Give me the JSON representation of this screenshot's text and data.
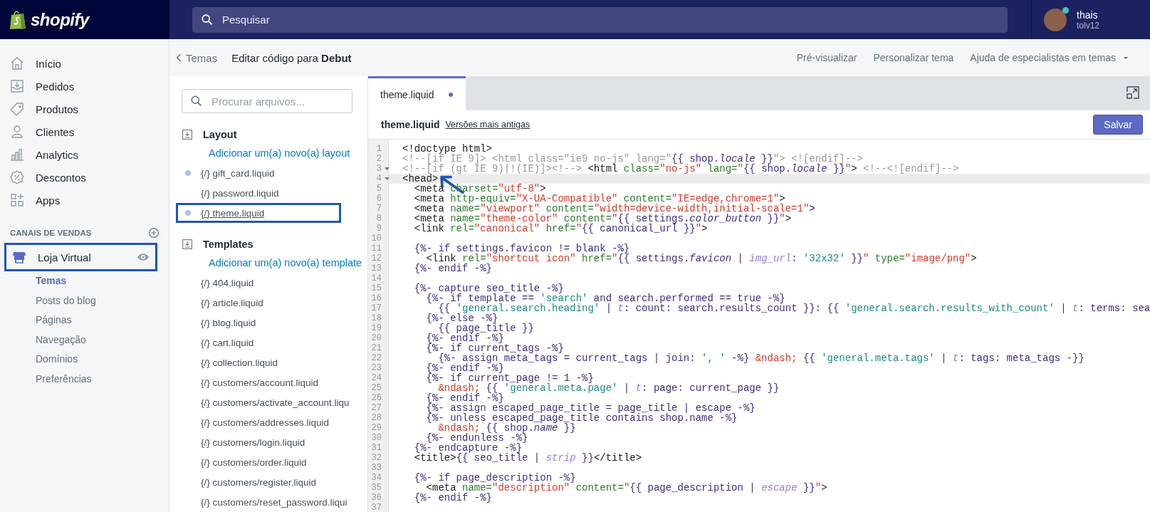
{
  "topbar": {
    "logo": "shopify",
    "search": {
      "placeholder": "Pesquisar"
    },
    "user": {
      "name": "thais",
      "store": "tolv12",
      "online": true
    }
  },
  "nav": {
    "items": [
      {
        "label": "Início",
        "selected": false
      },
      {
        "label": "Pedidos",
        "selected": false
      },
      {
        "label": "Produtos",
        "selected": false
      },
      {
        "label": "Clientes",
        "selected": false
      },
      {
        "label": "Analytics",
        "selected": false
      },
      {
        "label": "Descontos",
        "selected": false
      },
      {
        "label": "Apps",
        "selected": false
      }
    ],
    "channels_heading": "CANAIS DE VENDAS",
    "channel": {
      "label": "Loja Virtual",
      "annotated": true
    },
    "subitems": [
      {
        "label": "Temas",
        "selected": true
      },
      {
        "label": "Posts do blog",
        "selected": false
      },
      {
        "label": "Páginas",
        "selected": false
      },
      {
        "label": "Navegação",
        "selected": false
      },
      {
        "label": "Domínios",
        "selected": false
      },
      {
        "label": "Preferências",
        "selected": false
      }
    ]
  },
  "page_header": {
    "back": "Temas",
    "title": "Editar código para **Debut**",
    "actions": [
      {
        "label": "Pré-visualizar",
        "dropdown": false
      },
      {
        "label": "Personalizar tema",
        "dropdown": false
      },
      {
        "label": "Ajuda de especialistas em temas",
        "dropdown": true
      }
    ]
  },
  "files": {
    "search": {
      "placeholder": "Procurar arquivos..."
    },
    "sections": [
      {
        "title": "Layout",
        "add_link": "Adicionar um(a) novo(a) layout",
        "items": [
          {
            "glyph": "{/}",
            "name": "gift_card.liquid",
            "modified": true,
            "selected": false,
            "annotated": false
          },
          {
            "glyph": "{/}",
            "name": "password.liquid",
            "modified": false,
            "selected": false,
            "annotated": false
          },
          {
            "glyph": "{/}",
            "name": "theme.liquid",
            "modified": true,
            "selected": true,
            "annotated": true
          }
        ]
      },
      {
        "title": "Templates",
        "add_link": "Adicionar um(a) novo(a) template",
        "items": [
          {
            "glyph": "{/}",
            "name": "404.liquid",
            "modified": false,
            "selected": false,
            "annotated": false
          },
          {
            "glyph": "{/}",
            "name": "article.liquid",
            "modified": false,
            "selected": false,
            "annotated": false
          },
          {
            "glyph": "{/}",
            "name": "blog.liquid",
            "modified": false,
            "selected": false,
            "annotated": false
          },
          {
            "glyph": "{/}",
            "name": "cart.liquid",
            "modified": false,
            "selected": false,
            "annotated": false
          },
          {
            "glyph": "{/}",
            "name": "collection.liquid",
            "modified": false,
            "selected": false,
            "annotated": false
          },
          {
            "glyph": "{/}",
            "name": "customers/account.liquid",
            "modified": false,
            "selected": false,
            "annotated": false
          },
          {
            "glyph": "{/}",
            "name": "customers/activate_account.liqu",
            "modified": false,
            "selected": false,
            "annotated": false
          },
          {
            "glyph": "{/}",
            "name": "customers/addresses.liquid",
            "modified": false,
            "selected": false,
            "annotated": false
          },
          {
            "glyph": "{/}",
            "name": "customers/login.liquid",
            "modified": false,
            "selected": false,
            "annotated": false
          },
          {
            "glyph": "{/}",
            "name": "customers/order.liquid",
            "modified": false,
            "selected": false,
            "annotated": false
          },
          {
            "glyph": "{/}",
            "name": "customers/register.liquid",
            "modified": false,
            "selected": false,
            "annotated": false
          },
          {
            "glyph": "{/}",
            "name": "customers/reset_password.liqui",
            "modified": false,
            "selected": false,
            "annotated": false
          }
        ]
      }
    ]
  },
  "editor": {
    "tabs": [
      {
        "label": "theme.liquid",
        "unsaved": true,
        "selected": true
      }
    ],
    "file_name": "theme.liquid",
    "versions_link": "Versões mais antigas",
    "save_button": "Salvar",
    "lines": [
      {
        "number": "1",
        "tokens": [
          {
            "kind": "plain",
            "text": "<!doctype html>"
          }
        ]
      },
      {
        "number": "2",
        "tokens": [
          {
            "kind": "comment",
            "text": "<!--[if IE 9]> <html class=\"ie9 no-js\" lang=\""
          },
          {
            "kind": "liquid",
            "text": "{{ shop."
          },
          {
            "kind": "prop",
            "text": "locale"
          },
          {
            "kind": "liquid",
            "text": " }}"
          },
          {
            "kind": "comment",
            "text": "\"> <![endif]-->"
          }
        ]
      },
      {
        "number": "3",
        "fold": true,
        "tokens": [
          {
            "kind": "comment",
            "text": "<!--[if (gt IE 9)|!(IE)]><!-->"
          },
          {
            "kind": "plain",
            "text": " <html "
          },
          {
            "kind": "attr",
            "text": "class="
          },
          {
            "kind": "string",
            "text": "\"no-js\""
          },
          {
            "kind": "attr",
            "text": " lang="
          },
          {
            "kind": "string",
            "text": "\""
          },
          {
            "kind": "liquid",
            "text": "{{ shop."
          },
          {
            "kind": "prop",
            "text": "locale"
          },
          {
            "kind": "liquid",
            "text": " }}"
          },
          {
            "kind": "string",
            "text": "\""
          },
          {
            "kind": "plain",
            "text": "> "
          },
          {
            "kind": "comment",
            "text": "<!--<![endif]-->"
          }
        ]
      },
      {
        "number": "4",
        "fold": true,
        "active": true,
        "annotated": true,
        "tokens": [
          {
            "kind": "plain",
            "text": "<head>"
          }
        ]
      },
      {
        "number": "5",
        "tokens": [
          {
            "kind": "plain",
            "text": "  <meta "
          },
          {
            "kind": "attr",
            "text": "charset="
          },
          {
            "kind": "string",
            "text": "\"utf-8\""
          },
          {
            "kind": "plain",
            "text": ">"
          }
        ]
      },
      {
        "number": "6",
        "tokens": [
          {
            "kind": "plain",
            "text": "  <meta "
          },
          {
            "kind": "attr",
            "text": "http-equiv="
          },
          {
            "kind": "string",
            "text": "\"X-UA-Compatible\""
          },
          {
            "kind": "attr",
            "text": " content="
          },
          {
            "kind": "string",
            "text": "\"IE=edge,chrome=1\""
          },
          {
            "kind": "plain",
            "text": ">"
          }
        ]
      },
      {
        "number": "7",
        "tokens": [
          {
            "kind": "plain",
            "text": "  <meta "
          },
          {
            "kind": "attr",
            "text": "name="
          },
          {
            "kind": "string",
            "text": "\"viewport\""
          },
          {
            "kind": "attr",
            "text": " content="
          },
          {
            "kind": "string",
            "text": "\"width=device-width,initial-scale=1\""
          },
          {
            "kind": "plain",
            "text": ">"
          }
        ]
      },
      {
        "number": "8",
        "tokens": [
          {
            "kind": "plain",
            "text": "  <meta "
          },
          {
            "kind": "attr",
            "text": "name="
          },
          {
            "kind": "string",
            "text": "\"theme-color\""
          },
          {
            "kind": "attr",
            "text": " content="
          },
          {
            "kind": "string",
            "text": "\""
          },
          {
            "kind": "liquid",
            "text": "{{ settings."
          },
          {
            "kind": "prop",
            "text": "color_button"
          },
          {
            "kind": "liquid",
            "text": " }}"
          },
          {
            "kind": "string",
            "text": "\""
          },
          {
            "kind": "plain",
            "text": ">"
          }
        ]
      },
      {
        "number": "9",
        "tokens": [
          {
            "kind": "plain",
            "text": "  <link "
          },
          {
            "kind": "attr",
            "text": "rel="
          },
          {
            "kind": "string",
            "text": "\"canonical\""
          },
          {
            "kind": "attr",
            "text": " href="
          },
          {
            "kind": "string",
            "text": "\""
          },
          {
            "kind": "liquid",
            "text": "{{ canonical_url }}"
          },
          {
            "kind": "string",
            "text": "\""
          },
          {
            "kind": "plain",
            "text": ">"
          }
        ]
      },
      {
        "number": "10"
      },
      {
        "number": "11",
        "tokens": [
          {
            "kind": "liquid",
            "text": "  {%- if settings.favicon != blank -%}"
          }
        ]
      },
      {
        "number": "12",
        "tokens": [
          {
            "kind": "plain",
            "text": "    <link "
          },
          {
            "kind": "attr",
            "text": "rel="
          },
          {
            "kind": "string",
            "text": "\"shortcut icon\""
          },
          {
            "kind": "attr",
            "text": " href="
          },
          {
            "kind": "string",
            "text": "\""
          },
          {
            "kind": "liquid",
            "text": "{{ settings."
          },
          {
            "kind": "prop",
            "text": "favicon"
          },
          {
            "kind": "liquid",
            "text": " | "
          },
          {
            "kind": "filter",
            "text": "img_url"
          },
          {
            "kind": "liquid",
            "text": ": "
          },
          {
            "kind": "quote",
            "text": "'32x32'"
          },
          {
            "kind": "liquid",
            "text": " }}"
          },
          {
            "kind": "string",
            "text": "\""
          },
          {
            "kind": "attr",
            "text": " type="
          },
          {
            "kind": "string",
            "text": "\"image/png\""
          },
          {
            "kind": "plain",
            "text": ">"
          }
        ]
      },
      {
        "number": "13",
        "tokens": [
          {
            "kind": "liquid",
            "text": "  {%- endif -%}"
          }
        ]
      },
      {
        "number": "14"
      },
      {
        "number": "15",
        "tokens": [
          {
            "kind": "liquid",
            "text": "  {%- capture seo_title -%}"
          }
        ]
      },
      {
        "number": "16",
        "tokens": [
          {
            "kind": "liquid",
            "text": "    {%- if template == "
          },
          {
            "kind": "quote",
            "text": "'search'"
          },
          {
            "kind": "liquid",
            "text": " and search.performed == true -%}"
          }
        ]
      },
      {
        "number": "17",
        "tokens": [
          {
            "kind": "liquid",
            "text": "      {{ "
          },
          {
            "kind": "quote",
            "text": "'general.search.heading'"
          },
          {
            "kind": "liquid",
            "text": " | "
          },
          {
            "kind": "filter",
            "text": "t"
          },
          {
            "kind": "liquid",
            "text": ": count: search.results_count }}: {{ "
          },
          {
            "kind": "quote",
            "text": "'general.search.results_with_count'"
          },
          {
            "kind": "liquid",
            "text": " | "
          },
          {
            "kind": "filter",
            "text": "t"
          },
          {
            "kind": "liquid",
            "text": ": terms: sea"
          }
        ]
      },
      {
        "number": "18",
        "tokens": [
          {
            "kind": "liquid",
            "text": "    {%- else -%}"
          }
        ]
      },
      {
        "number": "19",
        "tokens": [
          {
            "kind": "liquid",
            "text": "      {{ page_title }}"
          }
        ]
      },
      {
        "number": "20",
        "tokens": [
          {
            "kind": "liquid",
            "text": "    {%- endif -%}"
          }
        ]
      },
      {
        "number": "21",
        "tokens": [
          {
            "kind": "liquid",
            "text": "    {%- if current_tags -%}"
          }
        ]
      },
      {
        "number": "22",
        "tokens": [
          {
            "kind": "liquid",
            "text": "      {%- assign meta_tags = current_tags | join: "
          },
          {
            "kind": "quote",
            "text": "', '"
          },
          {
            "kind": "liquid",
            "text": " -%} "
          },
          {
            "kind": "entity",
            "text": "&ndash;"
          },
          {
            "kind": "liquid",
            "text": " {{ "
          },
          {
            "kind": "quote",
            "text": "'general.meta.tags'"
          },
          {
            "kind": "liquid",
            "text": " | "
          },
          {
            "kind": "filter",
            "text": "t"
          },
          {
            "kind": "liquid",
            "text": ": tags: meta_tags -}}"
          }
        ]
      },
      {
        "number": "23",
        "tokens": [
          {
            "kind": "liquid",
            "text": "    {%- endif -%}"
          }
        ]
      },
      {
        "number": "24",
        "tokens": [
          {
            "kind": "liquid",
            "text": "    {%- if current_page != 1 -%}"
          }
        ]
      },
      {
        "number": "25",
        "tokens": [
          {
            "kind": "entity",
            "text": "      &ndash;"
          },
          {
            "kind": "liquid",
            "text": " {{ "
          },
          {
            "kind": "quote",
            "text": "'general.meta.page'"
          },
          {
            "kind": "liquid",
            "text": " | "
          },
          {
            "kind": "filter",
            "text": "t"
          },
          {
            "kind": "liquid",
            "text": ": page: current_page }}"
          }
        ]
      },
      {
        "number": "26",
        "tokens": [
          {
            "kind": "liquid",
            "text": "    {%- endif -%}"
          }
        ]
      },
      {
        "number": "27",
        "tokens": [
          {
            "kind": "liquid",
            "text": "    {%- assign escaped_page_title = page_title | escape -%}"
          }
        ]
      },
      {
        "number": "28",
        "tokens": [
          {
            "kind": "liquid",
            "text": "    {%- unless escaped_page_title contains shop.name -%}"
          }
        ]
      },
      {
        "number": "29",
        "tokens": [
          {
            "kind": "entity",
            "text": "      &ndash;"
          },
          {
            "kind": "liquid",
            "text": " {{ shop."
          },
          {
            "kind": "prop",
            "text": "name"
          },
          {
            "kind": "liquid",
            "text": " }}"
          }
        ]
      },
      {
        "number": "30",
        "tokens": [
          {
            "kind": "liquid",
            "text": "    {%- endunless -%}"
          }
        ]
      },
      {
        "number": "31",
        "tokens": [
          {
            "kind": "liquid",
            "text": "  {%- endcapture -%}"
          }
        ]
      },
      {
        "number": "32",
        "tokens": [
          {
            "kind": "plain",
            "text": "  <title>"
          },
          {
            "kind": "liquid",
            "text": "{{ seo_title | "
          },
          {
            "kind": "filter",
            "text": "strip"
          },
          {
            "kind": "liquid",
            "text": " }}"
          },
          {
            "kind": "plain",
            "text": "</title>"
          }
        ]
      },
      {
        "number": "33"
      },
      {
        "number": "34",
        "tokens": [
          {
            "kind": "liquid",
            "text": "  {%- if page_description -%}"
          }
        ]
      },
      {
        "number": "35",
        "tokens": [
          {
            "kind": "plain",
            "text": "    <meta "
          },
          {
            "kind": "attr",
            "text": "name="
          },
          {
            "kind": "string",
            "text": "\"description\""
          },
          {
            "kind": "attr",
            "text": " content="
          },
          {
            "kind": "string",
            "text": "\""
          },
          {
            "kind": "liquid",
            "text": "{{ page_description | "
          },
          {
            "kind": "filter",
            "text": "escape"
          },
          {
            "kind": "liquid",
            "text": " }}"
          },
          {
            "kind": "string",
            "text": "\""
          },
          {
            "kind": "plain",
            "text": ">"
          }
        ]
      },
      {
        "number": "36",
        "tokens": [
          {
            "kind": "liquid",
            "text": "  {%- endif -%}"
          }
        ]
      },
      {
        "number": "37"
      }
    ]
  }
}
